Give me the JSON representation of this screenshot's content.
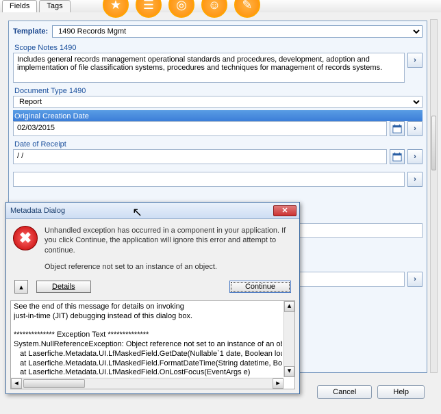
{
  "tabs": {
    "fields": "Fields",
    "tags": "Tags"
  },
  "template": {
    "label": "Template:",
    "value": "1490 Records Mgmt"
  },
  "sections": {
    "scope_notes": {
      "header": "Scope Notes 1490",
      "value": "Includes general records management operational standards and procedures, development, adoption and implementation of file classification systems, procedures and techniques for management of records systems."
    },
    "doc_type": {
      "header": "Document Type 1490",
      "value": "Report"
    },
    "orig_date": {
      "header": "Original Creation Date",
      "value": "02/03/2015"
    },
    "receipt": {
      "header": "Date of Receipt",
      "value": " /  /"
    }
  },
  "buttons": {
    "cancel": "Cancel",
    "help": "Help"
  },
  "dialog": {
    "title": "Metadata Dialog",
    "message": "Unhandled exception has occurred in a component in your application. If you click Continue, the application will ignore this error and attempt to continue.",
    "sub": "Object reference not set to an instance of an object.",
    "details": "Details",
    "continue": "Continue",
    "trace": "See the end of this message for details on invoking\njust-in-time (JIT) debugging instead of this dialog box.\n\n************** Exception Text **************\nSystem.NullReferenceException: Object reference not set to an instance of an obje\n   at Laserfiche.Metadata.UI.LfMaskedField.GetDate(Nullable`1 date, Boolean local\n   at Laserfiche.Metadata.UI.LfMaskedField.FormatDateTime(String datetime, Boole\n   at Laserfiche.Metadata.UI.LfMaskedField.OnLostFocus(EventArgs e)\n   at System.Windows.Forms.Control.WndProc(Message& m)\n   at Laserfiche.Metadata.UI.DragDropTextBox.WndProc(Message& m)"
  }
}
